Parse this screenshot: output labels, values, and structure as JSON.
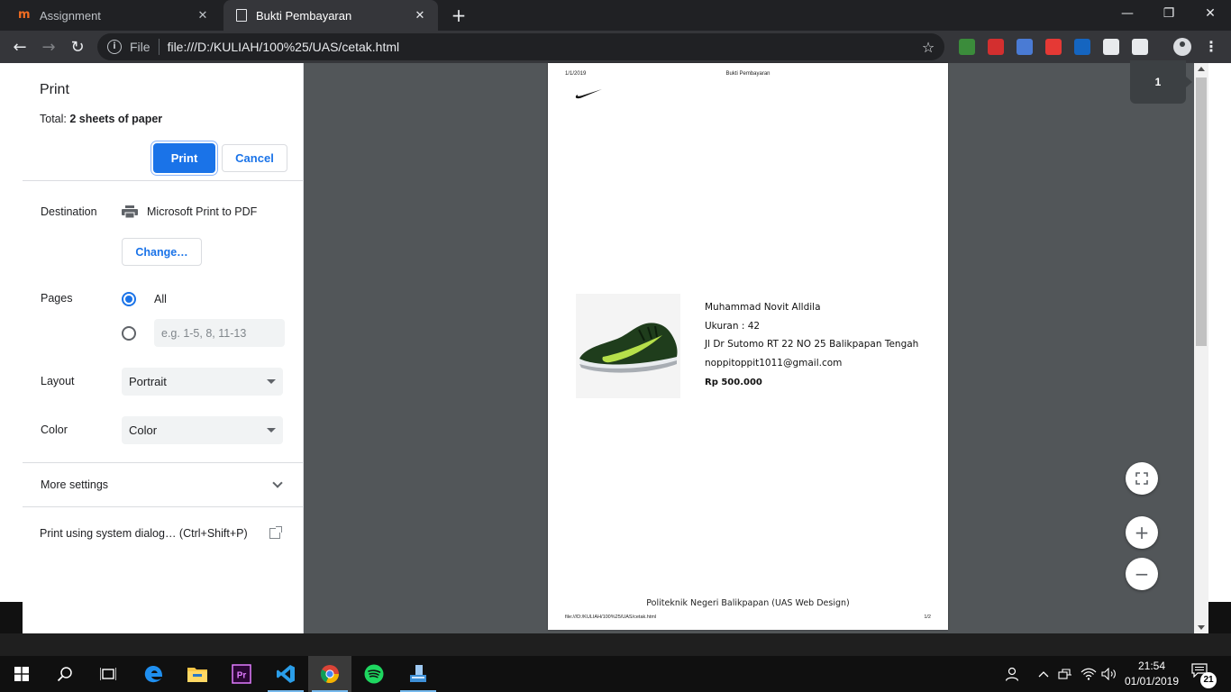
{
  "browser": {
    "tabs": [
      {
        "title": "Assignment",
        "icon": "moodle-m-icon",
        "active": false
      },
      {
        "title": "Bukti Pembayaran",
        "icon": "document-icon",
        "active": true
      }
    ],
    "new_tab_glyph": "+",
    "window_controls": {
      "minimize": "—",
      "restore": "❐",
      "close": "✕"
    },
    "address": {
      "scheme_label": "File",
      "url": "file:///D:/KULIAH/100%25/UAS/cetak.html",
      "info_glyph": "i",
      "star_glyph": "☆"
    },
    "nav": {
      "back": "←",
      "forward": "→",
      "reload": "↻"
    },
    "menu_glyph": "⋮",
    "extension_colors": [
      "#3b8c3b",
      "#d32f2f",
      "#4a7bd4",
      "#e53935",
      "#1565c0",
      "#e8eaed",
      "#e8eaed"
    ]
  },
  "print_dialog": {
    "title": "Print",
    "total_prefix": "Total: ",
    "total_value": "2 sheets of paper",
    "print_label": "Print",
    "cancel_label": "Cancel",
    "destination": {
      "label": "Destination",
      "value": "Microsoft Print to PDF",
      "change_label": "Change…"
    },
    "pages": {
      "label": "Pages",
      "all_label": "All",
      "custom_placeholder": "e.g. 1-5, 8, 11-13",
      "selected": "All"
    },
    "layout": {
      "label": "Layout",
      "value": "Portrait"
    },
    "color": {
      "label": "Color",
      "value": "Color"
    },
    "more_settings_label": "More settings",
    "system_dialog_label": "Print using system dialog… (Ctrl+Shift+P)"
  },
  "preview": {
    "page_indicator": "1",
    "zoom": {
      "fit": "⛶",
      "in": "+",
      "out": "−"
    },
    "document": {
      "header_date": "1/1/2019",
      "header_title": "Bukti Pembayaran",
      "name": "Muhammad Novit Alldila",
      "size": "Ukuran : 42",
      "address": "Jl Dr Sutomo RT 22 NO 25 Balikpapan Tengah",
      "email": "noppitoppit1011@gmail.com",
      "price": "Rp 500.000",
      "footer_text": "Politeknik Negeri Balikpapan (UAS Web Design)",
      "footer_url": "file:///D:/KULIAH/100%25/UAS/cetak.html",
      "footer_page": "1/2"
    }
  },
  "taskbar": {
    "apps": [
      "start-icon",
      "search-icon",
      "task-view-icon",
      "edge-icon",
      "file-explorer-icon",
      "premiere-icon",
      "vscode-icon",
      "chrome-icon",
      "spotify-icon",
      "app-icon"
    ],
    "clock_time": "21:54",
    "clock_date": "01/01/2019",
    "notification_count": "21"
  }
}
